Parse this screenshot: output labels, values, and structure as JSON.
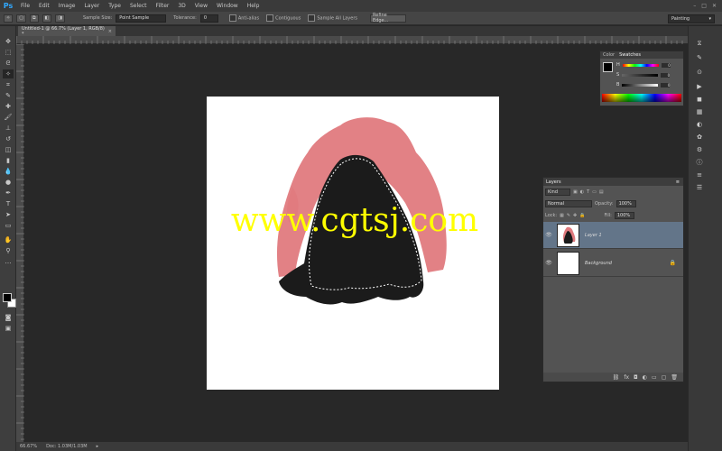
{
  "app": {
    "logo": "Ps",
    "menu": [
      "File",
      "Edit",
      "Image",
      "Layer",
      "Type",
      "Select",
      "Filter",
      "3D",
      "View",
      "Window",
      "Help"
    ],
    "window_controls": [
      "–",
      "□",
      "✕"
    ]
  },
  "options_bar": {
    "sample_size_label": "Sample Size:",
    "sample_size_value": "Point Sample",
    "tolerance_label": "Tolerance:",
    "tolerance_value": "0",
    "anti_alias_label": "Anti-alias",
    "contiguous_label": "Contiguous",
    "sample_all_layers_label": "Sample All Layers",
    "refine_edge_label": "Refine Edge..."
  },
  "workspace": {
    "value": "Painting"
  },
  "document": {
    "tab_title": "Untitled-1 @ 66.7% (Layer 1, RGB/8) *",
    "close_label": "×",
    "watermark": "www.cgtsj.com"
  },
  "status_bar": {
    "zoom": "66.67%",
    "doc_info": "Doc: 1.03M/1.03M"
  },
  "color_panel": {
    "tabs": [
      "Color",
      "Swatches"
    ],
    "active_tab": "Color",
    "channels": [
      {
        "label": "H",
        "value": "0"
      },
      {
        "label": "S",
        "value": "0"
      },
      {
        "label": "B",
        "value": "0"
      }
    ],
    "foreground": "#000000",
    "background": "#ffffff"
  },
  "layers_panel": {
    "title": "Layers",
    "kind_label": "Kind",
    "blend_mode": "Normal",
    "opacity_label": "Opacity:",
    "opacity_value": "100%",
    "lock_label": "Lock:",
    "fill_label": "Fill:",
    "fill_value": "100%",
    "layers": [
      {
        "name": "Layer 1",
        "selected": true,
        "locked": false
      },
      {
        "name": "Background",
        "selected": false,
        "locked": true
      }
    ]
  },
  "colors": {
    "accent_selection": "#637589",
    "pink_paint": "#e07a7e",
    "black_paint": "#1a1a1a",
    "watermark": "#ffff00"
  }
}
